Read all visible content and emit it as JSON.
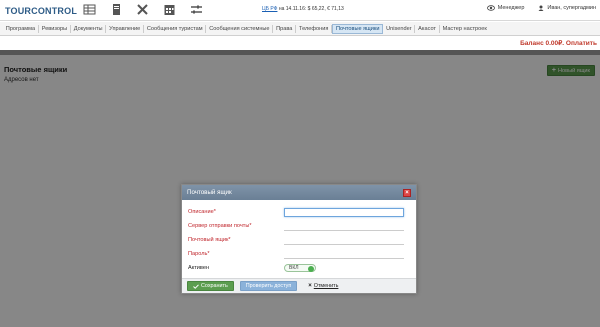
{
  "header": {
    "logo_text": "TOURCONTROL",
    "icons": [
      "table-icon",
      "document-icon",
      "tools-icon",
      "calendar-icon",
      "sliders-icon"
    ],
    "info_link": "ЦБ РФ",
    "info_text": "на 14.11.16: $ 65,22, € 71,13",
    "messages_label": "Менеджер",
    "user_label": "Иван, супергадмин"
  },
  "menu": {
    "items": [
      {
        "label": "Программа"
      },
      {
        "label": "Ревизоры"
      },
      {
        "label": "Документы"
      },
      {
        "label": "Управление"
      },
      {
        "label": "Сообщения туристам"
      },
      {
        "label": "Сообщения системные"
      },
      {
        "label": "Права"
      },
      {
        "label": "Телефония"
      },
      {
        "label": "Почтовые ящики",
        "active": true
      },
      {
        "label": "Unisender"
      },
      {
        "label": "Акасот"
      },
      {
        "label": "Мастер настроек"
      }
    ]
  },
  "balance": "Баланс 0.00₽. Оплатить",
  "page": {
    "title": "Почтовые ящики",
    "empty_text": "Адресов нет",
    "new_button": "Новый ящик"
  },
  "modal": {
    "title": "Почтовый ящик",
    "fields": [
      {
        "label": "Описание*",
        "value": "",
        "required": true
      },
      {
        "label": "Сервер отправки почты*",
        "value": "",
        "required": true
      },
      {
        "label": "Почтовый ящик*",
        "value": "",
        "required": true
      },
      {
        "label": "Пароль*",
        "value": "",
        "required": true
      }
    ],
    "active_label": "Активен",
    "toggle_label": "ВКЛ",
    "save_label": "Сохранить",
    "check_label": "Проверить доступ",
    "cancel_label": "Отменить"
  },
  "colors": {
    "accent": "#5b9d4f",
    "required": "#c0272d",
    "balance": "#c0392b",
    "active_tab": "#d6e6f4"
  }
}
